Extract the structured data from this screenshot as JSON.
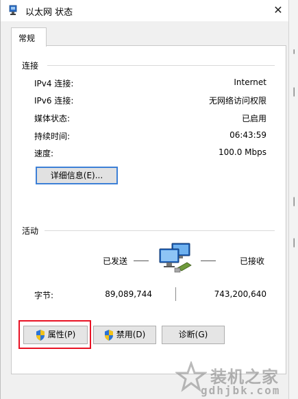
{
  "window": {
    "title": "以太网 状态",
    "close_label": "✕"
  },
  "tabs": [
    {
      "label": "常规"
    }
  ],
  "connection": {
    "group_label": "连接",
    "rows": [
      {
        "label": "IPv4 连接:",
        "value": "Internet"
      },
      {
        "label": "IPv6 连接:",
        "value": "无网络访问权限"
      },
      {
        "label": "媒体状态:",
        "value": "已启用"
      },
      {
        "label": "持续时间:",
        "value": "06:43:59"
      },
      {
        "label": "速度:",
        "value": "100.0 Mbps"
      }
    ],
    "details_button": "详细信息(E)..."
  },
  "activity": {
    "group_label": "活动",
    "sent_label": "已发送",
    "received_label": "已接收",
    "bytes_label": "字节:",
    "bytes_sent": "89,089,744",
    "bytes_received": "743,200,640"
  },
  "buttons": {
    "properties": "属性(P)",
    "disable": "禁用(D)",
    "diagnose": "诊断(G)"
  },
  "watermark": {
    "text": "装机之家",
    "url": "gdhjbk.com"
  },
  "colors": {
    "highlight": "#e81123",
    "focus_border": "#3c7fd6"
  }
}
